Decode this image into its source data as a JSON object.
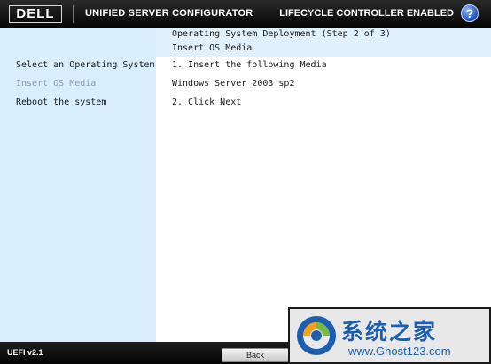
{
  "header": {
    "logo_text": "DELL",
    "product_title": "UNIFIED SERVER CONFIGURATOR",
    "status_title": "LIFECYCLE CONTROLLER ENABLED",
    "help_icon": "question-mark-icon"
  },
  "step": {
    "title": "Operating System Deployment (Step 2 of 3)",
    "subtitle": "Insert OS Media"
  },
  "sidebar": {
    "items": [
      {
        "label": "Select an Operating System",
        "state": "normal"
      },
      {
        "label": "Insert OS Media",
        "state": "current"
      },
      {
        "label": "Reboot the system",
        "state": "normal"
      }
    ]
  },
  "main": {
    "instruction_1": "1. Insert the following Media",
    "media_name": "Windows Server 2003 sp2",
    "instruction_2": "2. Click Next"
  },
  "footer": {
    "version": "UEFI v2.1",
    "back_label": "Back"
  },
  "watermark": {
    "text_cn": "系统之家",
    "url": "www.Ghost123.com"
  },
  "colors": {
    "sidebar_bg": "#d8eefc",
    "banner_bg": "#e0f0fc",
    "header_bg": "#111111",
    "inactive_text": "#8a9aa6",
    "watermark_blue": "#1c5fb0"
  }
}
